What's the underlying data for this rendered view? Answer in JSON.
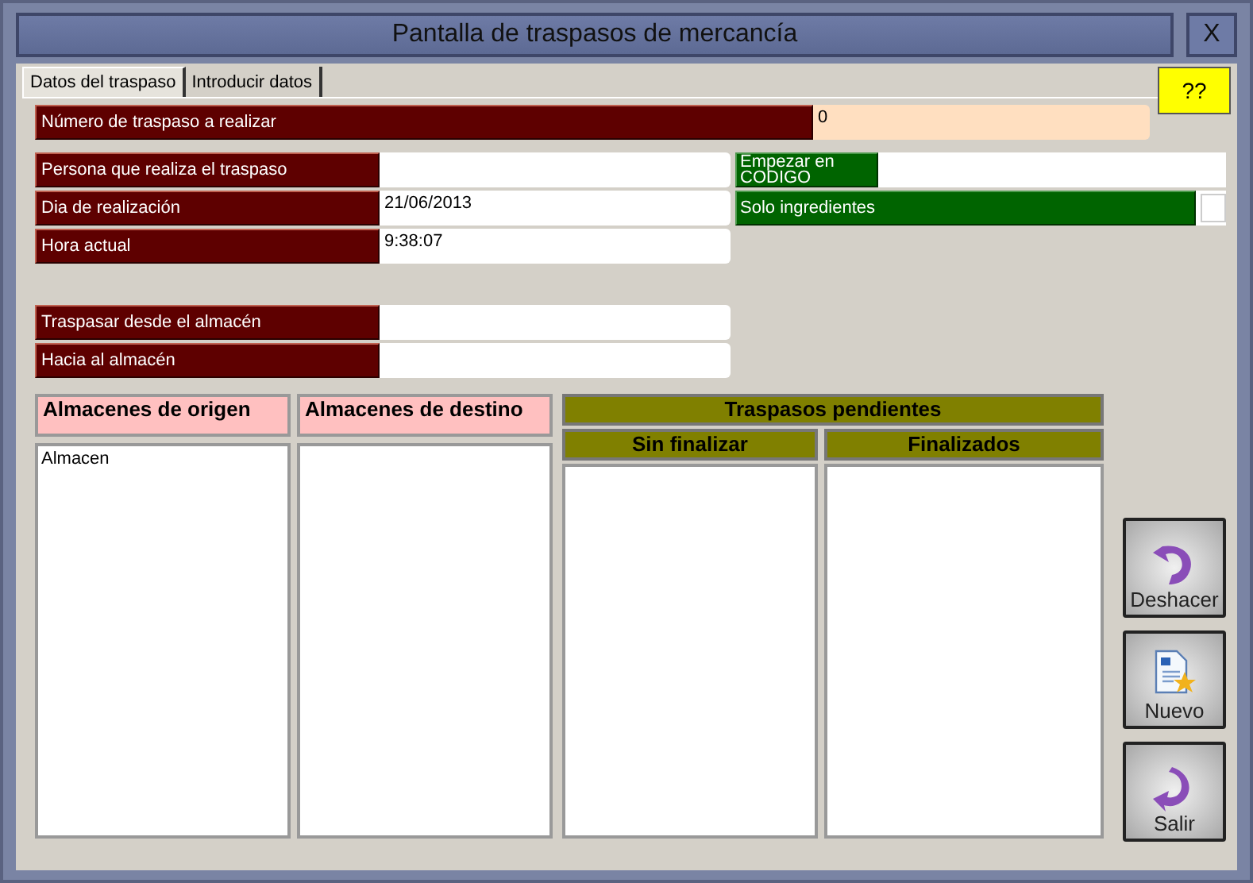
{
  "window": {
    "title": "Pantalla de traspasos de mercancía",
    "close": "X"
  },
  "tabs": [
    {
      "label": "Datos del traspaso",
      "selected": true
    },
    {
      "label": "Introducir datos",
      "selected": false
    }
  ],
  "help_button": "??",
  "transfer_number": {
    "label": "Número de traspaso a realizar",
    "value": "0"
  },
  "fields": [
    {
      "label": "Persona que realiza el traspaso"
    },
    {
      "label": "Dia de realización",
      "value": "21/06/2013"
    },
    {
      "label": "Hora actual",
      "value": "9:38:07"
    }
  ],
  "start_button": "Empezar en CODIGO",
  "only_ingredients": {
    "label": "Solo ingredientes",
    "checked": false
  },
  "warehouse_fields": [
    {
      "label": "Traspasar desde el almacén"
    },
    {
      "label": "Hacia al almacén"
    }
  ],
  "origin_list": {
    "header": "Almacenes de origen",
    "items": [
      "Almacen"
    ]
  },
  "destination_list": {
    "header": "Almacenes de destino"
  },
  "pending": {
    "header": "Traspasos pendientes",
    "columns": [
      {
        "header": "Sin finalizar"
      },
      {
        "header": "Finalizados"
      }
    ]
  },
  "actions": [
    {
      "kind": "undo",
      "label": "Deshacer"
    },
    {
      "kind": "new",
      "label": "Nuevo"
    },
    {
      "kind": "exit",
      "label": "Salir"
    }
  ]
}
